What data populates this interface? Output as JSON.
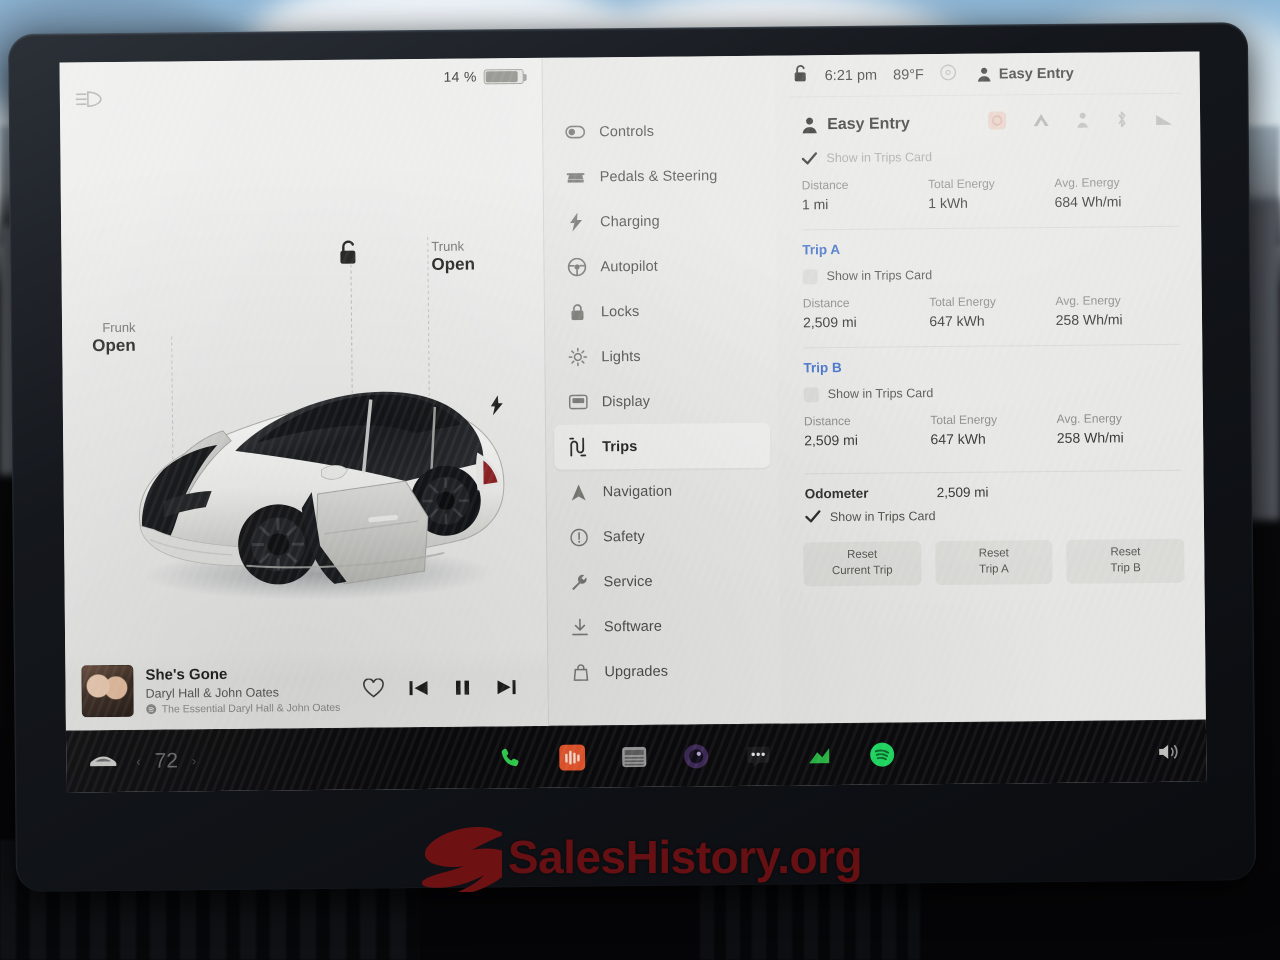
{
  "status_bar": {
    "battery_percent": "14 %",
    "time": "6:21 pm",
    "temperature": "89°F",
    "profile_name": "Easy Entry",
    "lock_icon": "unlocked-padlock-icon",
    "headlight_icon": "headlight-icon",
    "fan_icon": "fan-icon"
  },
  "car_visualization": {
    "frunk_label": "Frunk",
    "frunk_state": "Open",
    "trunk_label": "Trunk",
    "trunk_state": "Open",
    "lock_icon": "unlocked-padlock-icon",
    "charge_icon": "charge-bolt-icon"
  },
  "media_player": {
    "track_title": "She's Gone",
    "artist": "Daryl Hall & John Oates",
    "album": "The Essential Daryl Hall & John Oates",
    "favorite_icon": "heart-icon",
    "previous_icon": "skip-previous-icon",
    "pause_icon": "pause-icon",
    "next_icon": "skip-next-icon"
  },
  "settings_menu": {
    "items": [
      {
        "label": "Controls",
        "icon": "toggle-switch-icon",
        "active": false
      },
      {
        "label": "Pedals & Steering",
        "icon": "car-seat-icon",
        "active": false
      },
      {
        "label": "Charging",
        "icon": "lightning-bolt-icon",
        "active": false
      },
      {
        "label": "Autopilot",
        "icon": "steering-wheel-icon",
        "active": false
      },
      {
        "label": "Locks",
        "icon": "lock-icon",
        "active": false
      },
      {
        "label": "Lights",
        "icon": "sun-lights-icon",
        "active": false
      },
      {
        "label": "Display",
        "icon": "display-icon",
        "active": false
      },
      {
        "label": "Trips",
        "icon": "winding-road-icon",
        "active": true
      },
      {
        "label": "Navigation",
        "icon": "navigation-arrow-icon",
        "active": false
      },
      {
        "label": "Safety",
        "icon": "warning-circle-icon",
        "active": false
      },
      {
        "label": "Service",
        "icon": "wrench-icon",
        "active": false
      },
      {
        "label": "Software",
        "icon": "download-icon",
        "active": false
      },
      {
        "label": "Upgrades",
        "icon": "shopping-bag-icon",
        "active": false
      }
    ]
  },
  "trips_panel": {
    "header_profile": "Easy Entry",
    "header_profile_icon": "person-icon",
    "header_icons": [
      "recording-icon",
      "tent-icon",
      "person-small-icon",
      "bluetooth-icon",
      "signal-icon"
    ],
    "stat_labels": {
      "distance": "Distance",
      "total_energy": "Total Energy",
      "avg_energy": "Avg. Energy"
    },
    "show_in_trips_card_label": "Show in Trips Card",
    "sections": [
      {
        "title": "Easy Entry",
        "is_current": true,
        "checked": true,
        "distance": "1 mi",
        "total_energy": "1 kWh",
        "avg_energy": "684 Wh/mi"
      },
      {
        "title": "Trip A",
        "is_current": false,
        "checked": false,
        "distance": "2,509 mi",
        "total_energy": "647 kWh",
        "avg_energy": "258 Wh/mi"
      },
      {
        "title": "Trip B",
        "is_current": false,
        "checked": false,
        "distance": "2,509 mi",
        "total_energy": "647 kWh",
        "avg_energy": "258 Wh/mi"
      }
    ],
    "odometer": {
      "label": "Odometer",
      "value": "2,509 mi",
      "checked": true,
      "show_in_trips_card_label": "Show in Trips Card"
    },
    "reset_buttons": [
      {
        "line1": "Reset",
        "line2": "Current Trip"
      },
      {
        "line1": "Reset",
        "line2": "Trip A"
      },
      {
        "line1": "Reset",
        "line2": "Trip B"
      }
    ]
  },
  "dock": {
    "car_icon": "car-icon",
    "temperature": "72",
    "prev_icon": "chevron-left-icon",
    "next_icon": "chevron-right-icon",
    "apps": [
      {
        "name": "phone-app-icon",
        "color": "#2fd44e"
      },
      {
        "name": "media-app-icon",
        "color": "#e8552b"
      },
      {
        "name": "calendar-app-icon",
        "color": "#9a9a9a"
      },
      {
        "name": "camera-app-icon",
        "color": "#6a3f8f"
      },
      {
        "name": "more-apps-icon",
        "color": "#d7d7d7"
      },
      {
        "name": "energy-app-icon",
        "color": "#2fd44e"
      },
      {
        "name": "spotify-app-icon",
        "color": "#1ed760"
      }
    ],
    "volume_icon": "volume-icon"
  },
  "watermark": {
    "text": "SalesHistory.org",
    "logo_icon": "swoosh-logo-icon",
    "color": "#6e1113"
  }
}
